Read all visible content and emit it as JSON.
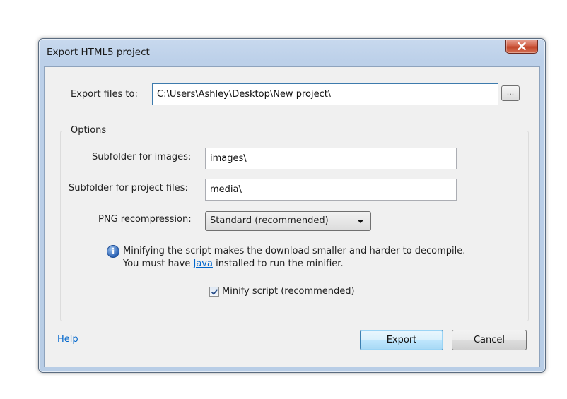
{
  "window": {
    "title": "Export HTML5 project"
  },
  "export": {
    "label": "Export files to:",
    "path": "C:\\Users\\Ashley\\Desktop\\New project\\",
    "browse_label": "..."
  },
  "options": {
    "legend": "Options",
    "images_label": "Subfolder for images:",
    "images_value": "images\\",
    "project_files_label": "Subfolder for project files:",
    "project_files_value": "media\\",
    "png_label": "PNG recompression:",
    "png_selected": "Standard (recommended)",
    "info_line1": "Minifying the script makes the download smaller and harder to decompile.",
    "info_line2_prefix": "You must have ",
    "info_link": "Java",
    "info_line2_suffix": " installed to run the minifier.",
    "minify_label": "Minify script (recommended)",
    "minify_checked": true
  },
  "footer": {
    "help": "Help",
    "export_button": "Export",
    "cancel_button": "Cancel"
  },
  "icons": {
    "close": "close-icon",
    "info": "info-icon",
    "check": "checkmark-icon",
    "dropdown": "chevron-down-icon"
  },
  "colors": {
    "link": "#0066cc",
    "close_button": "#c2452a",
    "default_button_border": "#3c7fb1"
  }
}
